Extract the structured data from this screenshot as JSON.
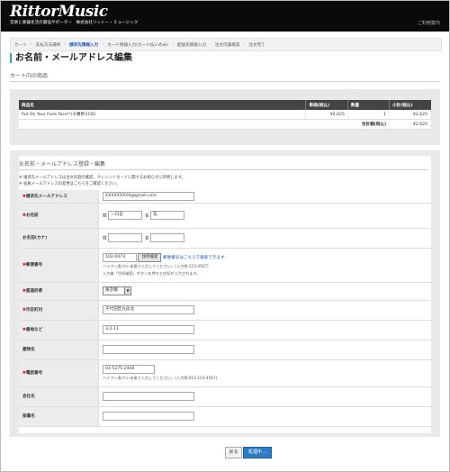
{
  "header": {
    "logo": "RittorMusic",
    "tagline": "音楽と楽器生活の最強サポーター　株式会社リットー・ミュージック",
    "help": "ご利用案内"
  },
  "breadcrumb": [
    "カート",
    "支払方法選択",
    "請求先情報入力",
    "カード情報入力(カード払いのみ)",
    "配送先情報入力",
    "注文内容確認",
    "注文完了"
  ],
  "breadcrumb_active_index": 2,
  "page_title": "お名前・メールアドレス編集",
  "cart": {
    "heading": "カート内の商品",
    "columns": [
      "商品名",
      "単価(税込)",
      "数量",
      "小計(税込)"
    ],
    "items": [
      {
        "name": "Put On Your Funk Face!!(そ備肝)(CD)",
        "unit_price": "¥2,625",
        "qty": "1",
        "subtotal": "¥2,625"
      }
    ],
    "total_label": "合計額(税込)",
    "total_value": "¥2,625"
  },
  "form": {
    "heading": "お名前・メールアドレス登録・編集",
    "note1": "※ 請求先メールアドレスは注文内容の確認、クレジットカードに関するお知らせに利用します。",
    "note2_pre": "※ 会員メールアドレスの変更は",
    "note2_link": "こちら",
    "note2_post": "をご確認ください。",
    "email_label": "請求先メールアドレス",
    "email_value": "XXXXXXXXX@gmail.com",
    "name_label": "お名前",
    "sei_label": "姓",
    "sei_value": "一口吾",
    "mei_label": "名",
    "mei_value": "玄",
    "kana_label": "お名前(カナ)",
    "kana_sei_label": "姓",
    "kana_mei_label": "名",
    "zip_label": "郵便番号",
    "zip_value": "102-0073",
    "zip_button": "住所検索",
    "zip_link": "郵便番号はこちらで検索できます",
    "zip_hint1": "ハイフン表り(←半角で入力してください。(入力例:123-4567)",
    "zip_hint2": "入力後「住所検索」ボタンを押すと住所が入力されます。",
    "pref_label": "都道府県",
    "pref_value": "東京都",
    "city_label": "市区町村",
    "city_value": "千代田区九段北",
    "street_label": "番地など",
    "street_value": "3-2-11",
    "building_label": "建物名",
    "tel_label": "電話番号",
    "tel_value": "03-5275-2446",
    "tel_hint": "ハイフン表り(←半角で入力してください。(入力例:012-123-4567)",
    "company_label": "会社名",
    "dept_label": "部署名"
  },
  "buttons": {
    "back": "戻る",
    "next": "処理中…"
  },
  "colors": {
    "accent": "#3a9bc8",
    "primary_button": "#2f7cc6",
    "required": "#cc0000",
    "link": "#1a5ab0"
  }
}
